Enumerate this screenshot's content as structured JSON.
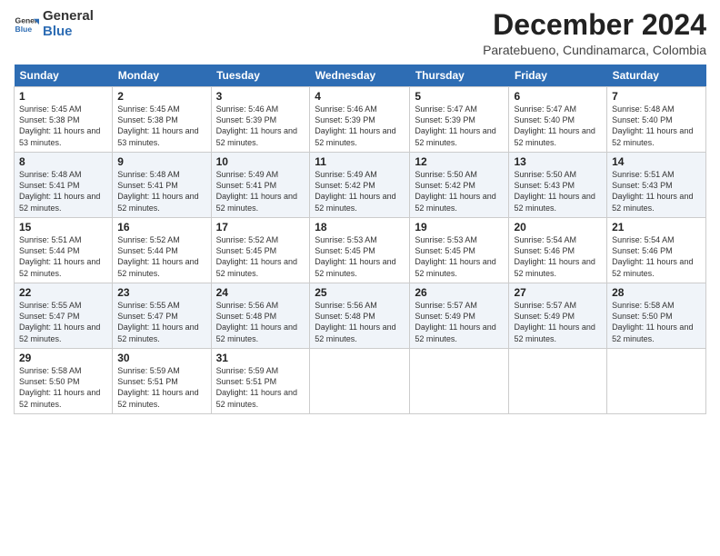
{
  "header": {
    "logo_line1": "General",
    "logo_line2": "Blue",
    "month_title": "December 2024",
    "subtitle": "Paratebueno, Cundinamarca, Colombia"
  },
  "days_of_week": [
    "Sunday",
    "Monday",
    "Tuesday",
    "Wednesday",
    "Thursday",
    "Friday",
    "Saturday"
  ],
  "weeks": [
    [
      {
        "day": "1",
        "sunrise": "5:45 AM",
        "sunset": "5:38 PM",
        "daylight": "11 hours and 53 minutes."
      },
      {
        "day": "2",
        "sunrise": "5:45 AM",
        "sunset": "5:38 PM",
        "daylight": "11 hours and 53 minutes."
      },
      {
        "day": "3",
        "sunrise": "5:46 AM",
        "sunset": "5:39 PM",
        "daylight": "11 hours and 52 minutes."
      },
      {
        "day": "4",
        "sunrise": "5:46 AM",
        "sunset": "5:39 PM",
        "daylight": "11 hours and 52 minutes."
      },
      {
        "day": "5",
        "sunrise": "5:47 AM",
        "sunset": "5:39 PM",
        "daylight": "11 hours and 52 minutes."
      },
      {
        "day": "6",
        "sunrise": "5:47 AM",
        "sunset": "5:40 PM",
        "daylight": "11 hours and 52 minutes."
      },
      {
        "day": "7",
        "sunrise": "5:48 AM",
        "sunset": "5:40 PM",
        "daylight": "11 hours and 52 minutes."
      }
    ],
    [
      {
        "day": "8",
        "sunrise": "5:48 AM",
        "sunset": "5:41 PM",
        "daylight": "11 hours and 52 minutes."
      },
      {
        "day": "9",
        "sunrise": "5:48 AM",
        "sunset": "5:41 PM",
        "daylight": "11 hours and 52 minutes."
      },
      {
        "day": "10",
        "sunrise": "5:49 AM",
        "sunset": "5:41 PM",
        "daylight": "11 hours and 52 minutes."
      },
      {
        "day": "11",
        "sunrise": "5:49 AM",
        "sunset": "5:42 PM",
        "daylight": "11 hours and 52 minutes."
      },
      {
        "day": "12",
        "sunrise": "5:50 AM",
        "sunset": "5:42 PM",
        "daylight": "11 hours and 52 minutes."
      },
      {
        "day": "13",
        "sunrise": "5:50 AM",
        "sunset": "5:43 PM",
        "daylight": "11 hours and 52 minutes."
      },
      {
        "day": "14",
        "sunrise": "5:51 AM",
        "sunset": "5:43 PM",
        "daylight": "11 hours and 52 minutes."
      }
    ],
    [
      {
        "day": "15",
        "sunrise": "5:51 AM",
        "sunset": "5:44 PM",
        "daylight": "11 hours and 52 minutes."
      },
      {
        "day": "16",
        "sunrise": "5:52 AM",
        "sunset": "5:44 PM",
        "daylight": "11 hours and 52 minutes."
      },
      {
        "day": "17",
        "sunrise": "5:52 AM",
        "sunset": "5:45 PM",
        "daylight": "11 hours and 52 minutes."
      },
      {
        "day": "18",
        "sunrise": "5:53 AM",
        "sunset": "5:45 PM",
        "daylight": "11 hours and 52 minutes."
      },
      {
        "day": "19",
        "sunrise": "5:53 AM",
        "sunset": "5:45 PM",
        "daylight": "11 hours and 52 minutes."
      },
      {
        "day": "20",
        "sunrise": "5:54 AM",
        "sunset": "5:46 PM",
        "daylight": "11 hours and 52 minutes."
      },
      {
        "day": "21",
        "sunrise": "5:54 AM",
        "sunset": "5:46 PM",
        "daylight": "11 hours and 52 minutes."
      }
    ],
    [
      {
        "day": "22",
        "sunrise": "5:55 AM",
        "sunset": "5:47 PM",
        "daylight": "11 hours and 52 minutes."
      },
      {
        "day": "23",
        "sunrise": "5:55 AM",
        "sunset": "5:47 PM",
        "daylight": "11 hours and 52 minutes."
      },
      {
        "day": "24",
        "sunrise": "5:56 AM",
        "sunset": "5:48 PM",
        "daylight": "11 hours and 52 minutes."
      },
      {
        "day": "25",
        "sunrise": "5:56 AM",
        "sunset": "5:48 PM",
        "daylight": "11 hours and 52 minutes."
      },
      {
        "day": "26",
        "sunrise": "5:57 AM",
        "sunset": "5:49 PM",
        "daylight": "11 hours and 52 minutes."
      },
      {
        "day": "27",
        "sunrise": "5:57 AM",
        "sunset": "5:49 PM",
        "daylight": "11 hours and 52 minutes."
      },
      {
        "day": "28",
        "sunrise": "5:58 AM",
        "sunset": "5:50 PM",
        "daylight": "11 hours and 52 minutes."
      }
    ],
    [
      {
        "day": "29",
        "sunrise": "5:58 AM",
        "sunset": "5:50 PM",
        "daylight": "11 hours and 52 minutes."
      },
      {
        "day": "30",
        "sunrise": "5:59 AM",
        "sunset": "5:51 PM",
        "daylight": "11 hours and 52 minutes."
      },
      {
        "day": "31",
        "sunrise": "5:59 AM",
        "sunset": "5:51 PM",
        "daylight": "11 hours and 52 minutes."
      },
      null,
      null,
      null,
      null
    ]
  ]
}
